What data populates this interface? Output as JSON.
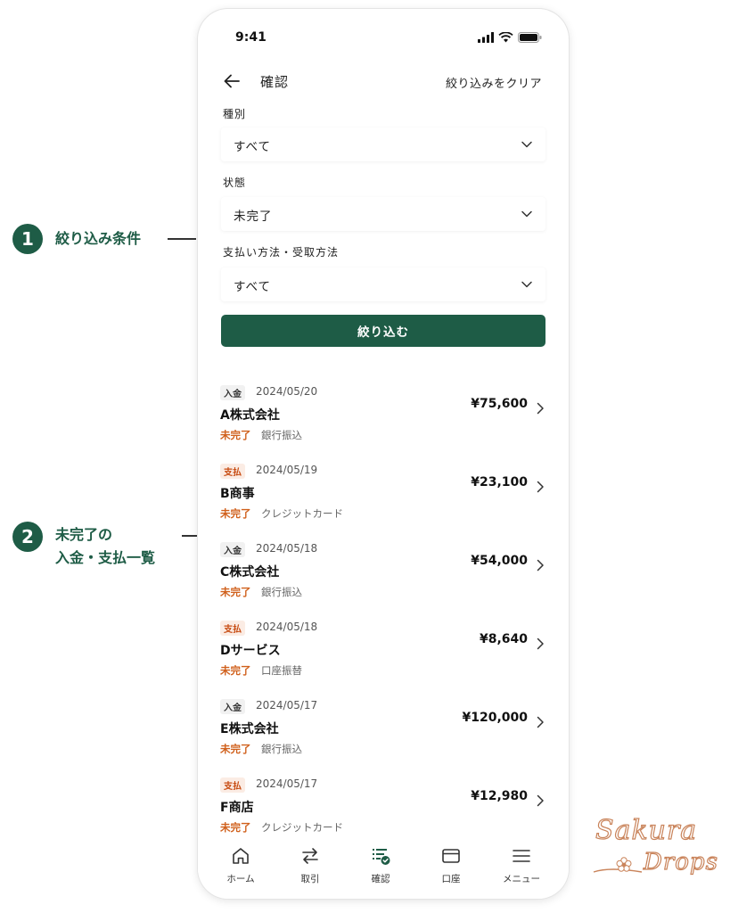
{
  "annotations": [
    {
      "number": "1",
      "text": "絞り込み条件"
    },
    {
      "number": "2",
      "line1": "未完了の",
      "line2": "入金・支払一覧"
    }
  ],
  "status_bar": {
    "time": "9:41"
  },
  "header": {
    "title": "確認",
    "clear_label": "絞り込みをクリア",
    "back_icon": "arrow-left-icon"
  },
  "filters": [
    {
      "label": "種別",
      "value": "すべて"
    },
    {
      "label": "状態",
      "value": "未完了"
    },
    {
      "label": "支払い方法・受取方法",
      "value": "すべて"
    }
  ],
  "apply_button": {
    "label": "絞り込む"
  },
  "transactions": [
    {
      "type": "入金",
      "type_kind": "in",
      "date": "2024/05/20",
      "name": "A株式会社",
      "status": "未完了",
      "method": "銀行振込",
      "amount": "¥75,600"
    },
    {
      "type": "支払",
      "type_kind": "out",
      "date": "2024/05/19",
      "name": "B商事",
      "status": "未完了",
      "method": "クレジットカード",
      "amount": "¥23,100"
    },
    {
      "type": "入金",
      "type_kind": "in",
      "date": "2024/05/18",
      "name": "C株式会社",
      "status": "未完了",
      "method": "銀行振込",
      "amount": "¥54,000"
    },
    {
      "type": "支払",
      "type_kind": "out",
      "date": "2024/05/18",
      "name": "Dサービス",
      "status": "未完了",
      "method": "口座振替",
      "amount": "¥8,640"
    },
    {
      "type": "入金",
      "type_kind": "in",
      "date": "2024/05/17",
      "name": "E株式会社",
      "status": "未完了",
      "method": "銀行振込",
      "amount": "¥120,000"
    },
    {
      "type": "支払",
      "type_kind": "out",
      "date": "2024/05/17",
      "name": "F商店",
      "status": "未完了",
      "method": "クレジットカード",
      "amount": "¥12,980"
    }
  ],
  "bottom_nav": [
    {
      "label": "ホーム",
      "icon": "home-icon"
    },
    {
      "label": "取引",
      "icon": "transfer-icon"
    },
    {
      "label": "確認",
      "icon": "checklist-icon",
      "active": true
    },
    {
      "label": "口座",
      "icon": "card-icon"
    },
    {
      "label": "メニュー",
      "icon": "menu-icon"
    }
  ],
  "logo": {
    "line1": "Sakura",
    "line2": "Drops"
  },
  "colors": {
    "primary": "#1e5c46",
    "incomplete": "#d0601c",
    "payment_badge_text": "#c74a10",
    "logo_stroke": "#c9835a"
  }
}
